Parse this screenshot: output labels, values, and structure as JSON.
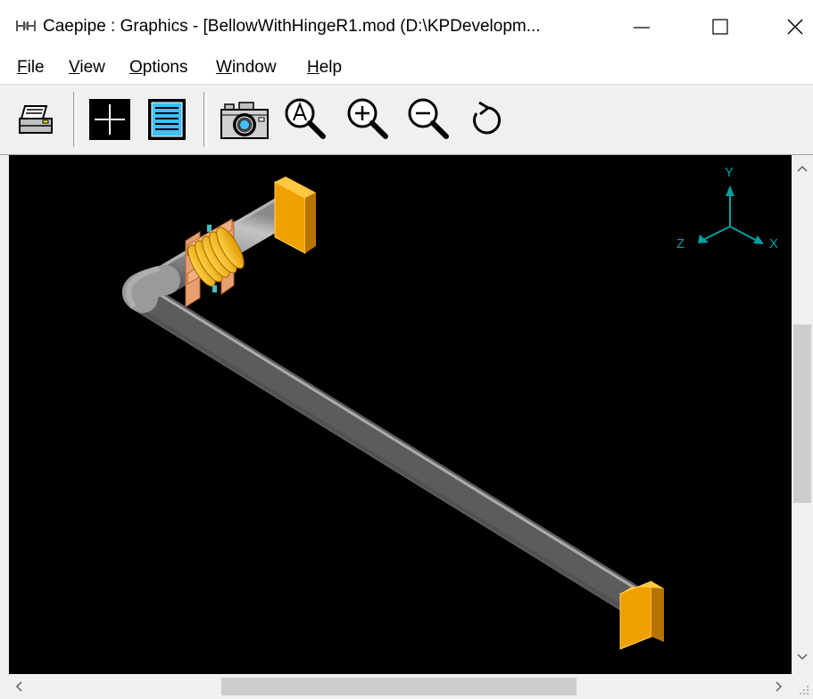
{
  "window": {
    "title": "Caepipe : Graphics -  [BellowWithHingeR1.mod (D:\\KPDevelopm..."
  },
  "menu": {
    "file": {
      "accel": "F",
      "rest": "ile"
    },
    "view": {
      "accel": "V",
      "rest": "iew"
    },
    "options": {
      "accel": "O",
      "rest": "ptions"
    },
    "window": {
      "accel": "W",
      "rest": "indow"
    },
    "help": {
      "accel": "H",
      "rest": "elp"
    }
  },
  "toolbar": {
    "icons": [
      "printer-icon",
      "crosshair-icon",
      "text-list-icon",
      "camera-icon",
      "zoom-all-icon",
      "zoom-in-icon",
      "zoom-out-icon",
      "rotate-icon"
    ]
  },
  "viewport": {
    "axes": {
      "y": "Y",
      "z": "Z",
      "x": "X"
    },
    "colors": {
      "background": "#000000",
      "pipe": "#a8a8a8",
      "anchor": "#f0a000",
      "bellow": "#ffc000",
      "axes": "#00a0a0"
    }
  }
}
